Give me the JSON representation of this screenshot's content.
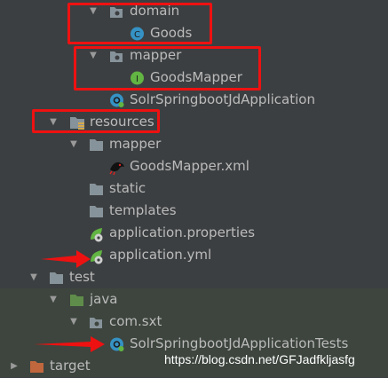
{
  "tree": {
    "domain": "domain",
    "goods": "Goods",
    "mapper_pkg": "mapper",
    "goods_mapper": "GoodsMapper",
    "app_class": "SolrSpringbootJdApplication",
    "resources": "resources",
    "mapper_dir": "mapper",
    "goods_mapper_xml": "GoodsMapper.xml",
    "static": "static",
    "templates": "templates",
    "app_properties": "application.properties",
    "app_yml": "application.yml",
    "test": "test",
    "java": "java",
    "com_sxt": "com.sxt",
    "app_tests": "SolrSpringbootJdApplicationTests",
    "target": "target"
  },
  "icons": {
    "class_badge": "C",
    "interface_badge": "I"
  },
  "watermark": "https://blog.csdn.net/GFJadfkljasfg",
  "colors": {
    "background": "#3c3f41",
    "text": "#bbbbbb",
    "folder": "#87939a",
    "source_folder": "#5f8c4a",
    "class_icon": "#3592c4",
    "interface_icon": "#62b543",
    "annotation_red": "#ee1111"
  }
}
